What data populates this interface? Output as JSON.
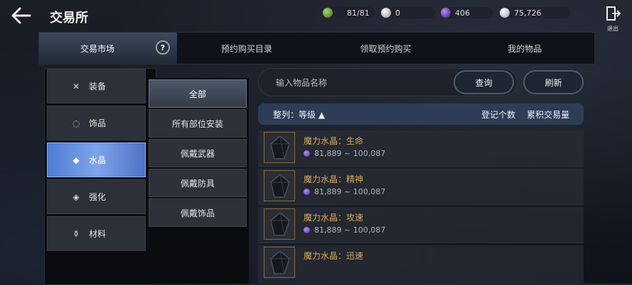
{
  "header": {
    "title": "交易所",
    "resources": [
      {
        "icon": "stamina-icon",
        "value": "81/81",
        "color": "#6fa644"
      },
      {
        "icon": "pearl-icon",
        "value": "0",
        "color": "#d8d0d0"
      },
      {
        "icon": "purple-crystal-icon",
        "value": "406",
        "color": "#7b3fd1"
      },
      {
        "icon": "silver-coin-icon",
        "value": "75,726",
        "color": "#c9d3dd"
      }
    ],
    "exit_label": "退出"
  },
  "tabs": [
    "交易市场",
    "预约购买目录",
    "领取预约购买",
    "我的物品"
  ],
  "help_label": "?",
  "categories": [
    {
      "label": "装备",
      "icon": "swords-icon"
    },
    {
      "label": "饰品",
      "icon": "ring-icon"
    },
    {
      "label": "水晶",
      "icon": "diamond-icon"
    },
    {
      "label": "强化",
      "icon": "upgrade-icon"
    },
    {
      "label": "材料",
      "icon": "potion-icon"
    }
  ],
  "subcategories": [
    "全部",
    "所有部位安装",
    "佩戴武器",
    "佩戴防具",
    "佩戴饰品"
  ],
  "search": {
    "placeholder": "输入物品名称",
    "query_label": "查询",
    "refresh_label": "刷新"
  },
  "sort": {
    "label": "整列：等级 ▲",
    "col1": "登记个数",
    "col2": "累积交易量"
  },
  "items": [
    {
      "name": "魔力水晶：生命",
      "price": "81,889 ~ 100,087"
    },
    {
      "name": "魔力水晶：精神",
      "price": "81,889 ~ 100,087"
    },
    {
      "name": "魔力水晶：攻速",
      "price": "81,889 ~ 100,087"
    },
    {
      "name": "魔力水晶：迅速",
      "price": ""
    }
  ],
  "colors": {
    "accent": "#4f7bd6",
    "item_name": "#d9a95a",
    "sort_bar": "#2d3d56"
  }
}
